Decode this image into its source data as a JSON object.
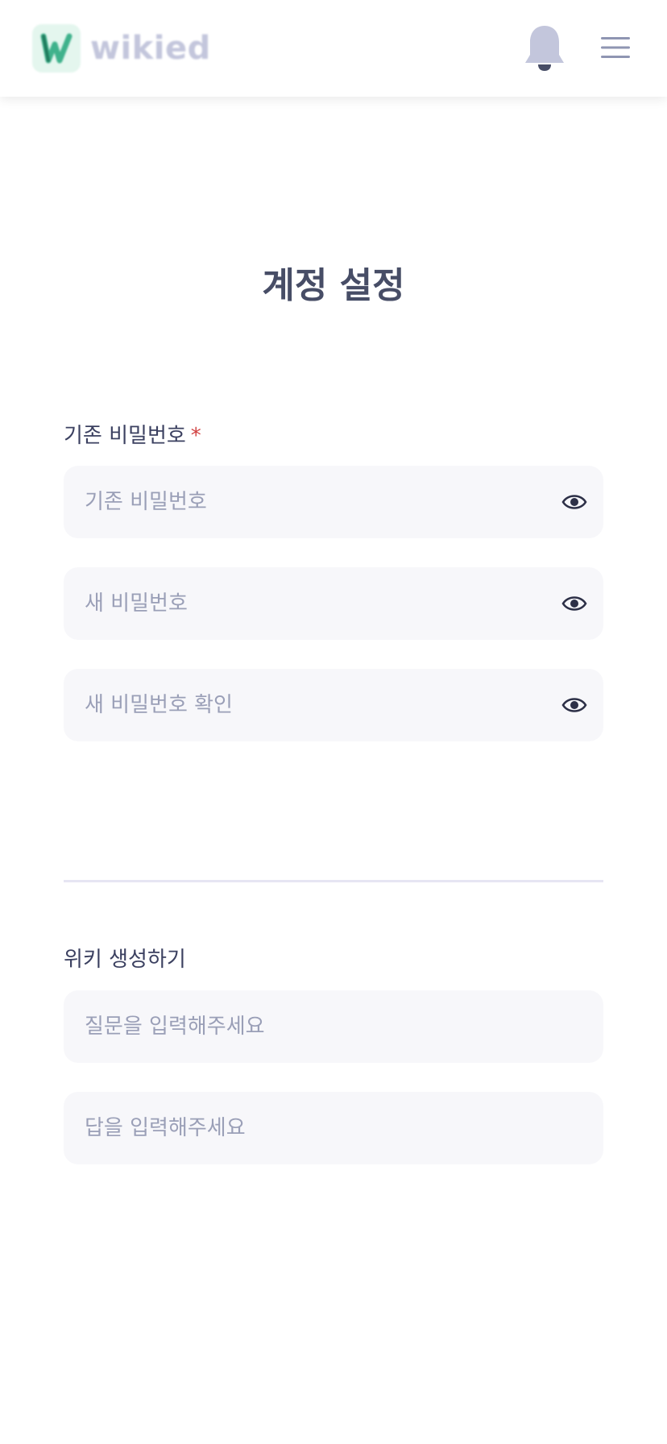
{
  "header": {
    "logo_text": "wikied",
    "logo_letter": "W",
    "icons": [
      "bell-icon",
      "hamburger-menu-icon"
    ]
  },
  "page": {
    "title": "계정 설정"
  },
  "password_section": {
    "label": "기존 비밀번호",
    "required_mark": "*",
    "fields": [
      {
        "placeholder": "기존 비밀번호",
        "value": "",
        "icon": "eye-icon"
      },
      {
        "placeholder": "새 비밀번호",
        "value": "",
        "icon": "eye-icon"
      },
      {
        "placeholder": "새 비밀번호 확인",
        "value": "",
        "icon": "eye-icon"
      }
    ]
  },
  "wiki_section": {
    "label": "위키 생성하기",
    "fields": [
      {
        "placeholder": "질문을 입력해주세요",
        "value": ""
      },
      {
        "placeholder": "답을 입력해주세요",
        "value": ""
      }
    ]
  },
  "colors": {
    "accent_green": "#3fb28c",
    "logo_text": "#c3c6dc",
    "title": "#474d66",
    "required": "#d14343",
    "field_bg": "#f7f7fa",
    "placeholder": "#9a9fb7"
  }
}
